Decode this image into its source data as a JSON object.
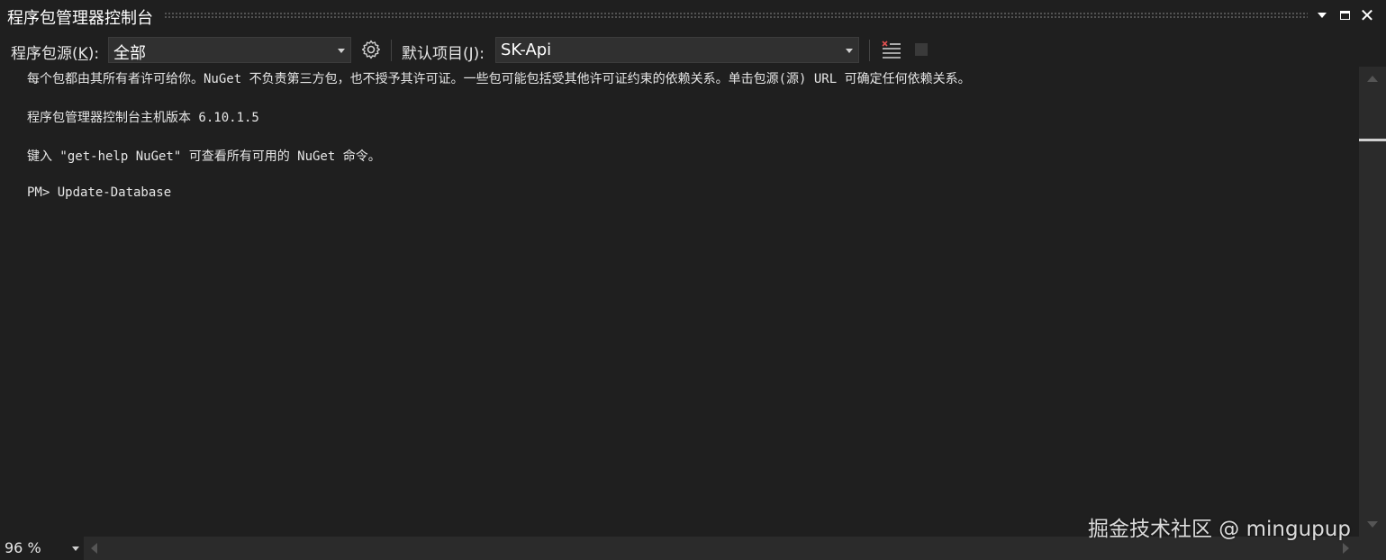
{
  "window": {
    "title": "程序包管理器控制台"
  },
  "toolbar": {
    "source_label_prefix": "程序包源(",
    "source_label_key": "K",
    "source_label_suffix": "):",
    "source_value": "全部",
    "project_label_prefix": "默认项目(",
    "project_label_key": "J",
    "project_label_suffix": "):",
    "project_value": "SK-Api",
    "settings_icon": "gear-icon",
    "clear_icon": "clear-console-icon",
    "stop_icon": "stop-icon"
  },
  "console": {
    "lines": [
      "每个包都由其所有者许可给你。NuGet 不负责第三方包，也不授予其许可证。一些包可能包括受其他许可证约束的依赖关系。单击包源(源) URL 可确定任何依赖关系。",
      "程序包管理器控制台主机版本 6.10.1.5",
      "键入 \"get-help NuGet\" 可查看所有可用的 NuGet 命令。",
      "PM> Update-Database"
    ]
  },
  "statusbar": {
    "zoom": "96 %"
  },
  "watermark": "掘金技术社区 @ mingupup",
  "colors": {
    "background": "#1f1f1f",
    "toolbar_select": "#303030",
    "text": "#e6e6e6",
    "clear_icon_accent": "#e05050"
  }
}
